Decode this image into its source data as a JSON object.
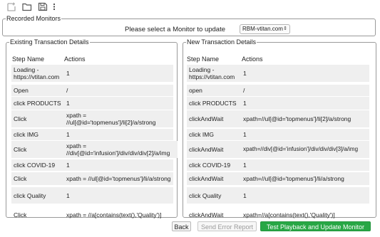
{
  "toolbar": {
    "icons": [
      "new-file-icon",
      "open-folder-icon",
      "save-icon",
      "more-options-icon"
    ]
  },
  "recorded_monitors": {
    "legend": "Recorded Monitors",
    "prompt": "Please select a Monitor to update",
    "selected": "RBM-vtitan.com"
  },
  "existing": {
    "legend": "Existing Transaction Details",
    "col_step": "Step Name",
    "col_actions": "Actions",
    "rows": [
      {
        "step": "Loading - https://vtitan.com",
        "action": "1"
      },
      {
        "step": "Open",
        "action": "/"
      },
      {
        "step": "click PRODUCTS",
        "action": "1"
      },
      {
        "step": "Click",
        "action": "xpath = //ul[@id='topmenus']/li[2]/a/strong"
      },
      {
        "step": "click IMG",
        "action": "1"
      },
      {
        "step": "Click",
        "action": "xpath = //div[@id='infusion']/div/div/div[2]/a/img"
      },
      {
        "step": "click COVID-19",
        "action": "1"
      },
      {
        "step": "Click",
        "action": "xpath = //ul[@id='topmenus']/li/a/strong"
      },
      {
        "step": "click Quality",
        "action": "1"
      },
      {
        "step": "Click",
        "action": "xpath = //a[contains(text(),'Quality')]"
      }
    ]
  },
  "new": {
    "legend": "New Transaction Details",
    "col_step": "Step Name",
    "col_actions": "Actions",
    "rows": [
      {
        "step": "Loading - https://vtitan.com",
        "action": "1"
      },
      {
        "step": "open",
        "action": "/"
      },
      {
        "step": "click PRODUCTS",
        "action": "1"
      },
      {
        "step": "clickAndWait",
        "action": "xpath=//ul[@id='topmenus']/li[2]/a/strong"
      },
      {
        "step": "click IMG",
        "action": "1"
      },
      {
        "step": "clickAndWait",
        "action": "xpath=//div[@id='infusion']/div/div/div[3]/a/img"
      },
      {
        "step": "click COVID-19",
        "action": "1"
      },
      {
        "step": "clickAndWait",
        "action": "xpath=//ul[@id='topmenus']/li/a/strong"
      },
      {
        "step": "click Quality",
        "action": "1"
      },
      {
        "step": "clickAndWait",
        "action": "xpath=//a[contains(text(),'Quality')]"
      }
    ]
  },
  "buttons": {
    "back": "Back",
    "send_error": "Send Error Report",
    "test_update": "Test Playback and Update Monitor"
  }
}
